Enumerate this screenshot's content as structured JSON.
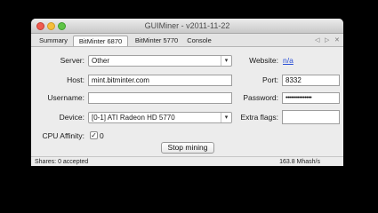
{
  "window": {
    "title": "GUIMiner - v2011-11-22"
  },
  "tabs": [
    {
      "label": "Summary"
    },
    {
      "label": "BitMinter 6870"
    },
    {
      "label": "BitMinter 5770"
    },
    {
      "label": "Console"
    }
  ],
  "tab_nav": {
    "prev": "◁",
    "next": "▷",
    "close": "✕"
  },
  "form": {
    "server_label": "Server:",
    "server_value": "Other",
    "website_label": "Website:",
    "website_value": "n/a",
    "host_label": "Host:",
    "host_value": "mint.bitminter.com",
    "port_label": "Port:",
    "port_value": "8332",
    "username_label": "Username:",
    "username_value": "",
    "password_label": "Password:",
    "password_value": "•••••••••••••••",
    "device_label": "Device:",
    "device_value": "[0-1] ATI Radeon HD 5770",
    "extra_flags_label": "Extra flags:",
    "extra_flags_value": "",
    "cpu_affinity_label": "CPU Affinity:",
    "cpu_affinity_checked_mark": "✓",
    "cpu_affinity_value": "0"
  },
  "actions": {
    "stop_mining_label": "Stop mining"
  },
  "status": {
    "left": "Shares: 0 accepted",
    "right": "163.8 Mhash/s"
  }
}
